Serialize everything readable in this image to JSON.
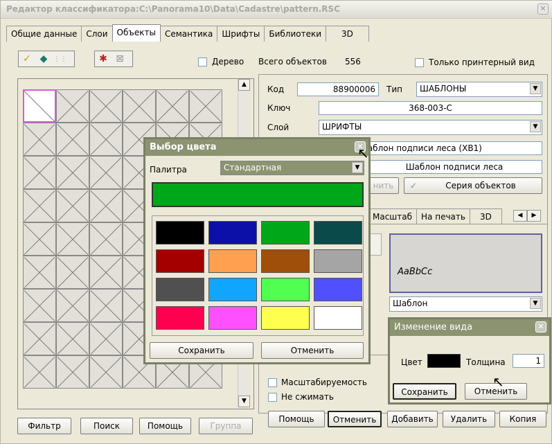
{
  "window": {
    "title": "Редактор классификатора:C:\\Panorama10\\Data\\Cadastre\\pattern.RSC"
  },
  "tabs": [
    "Общие данные",
    "Слои",
    "Объекты",
    "Семантика",
    "Шрифты",
    "Библиотеки",
    "3D"
  ],
  "toolbar": {
    "tree_label": "Дерево",
    "total_label": "Всего объектов",
    "total_value": "556",
    "printer_label": "Только принтерный вид"
  },
  "props": {
    "code_label": "Код",
    "code_value": "88900006",
    "type_label": "Тип",
    "type_value": "ШАБЛОНЫ",
    "key_label": "Ключ",
    "key_value": "368-003-С",
    "layer_label": "Слой",
    "layer_value": "ШРИФТЫ",
    "name_value": "Шаблон подписи леса (ХВ1)",
    "short_value": "Шаблон подписи леса",
    "apply_partial": "нить",
    "series_button": "Серия объектов"
  },
  "subtabs": [
    "Масштаб",
    "На печать",
    "3D"
  ],
  "preview_text": "AaBbCc",
  "template_value": "Шаблон",
  "checks": {
    "scalable": "Масштабируемость",
    "nocompress": "Не сжимать"
  },
  "left_buttons": [
    "Фильтр",
    "Поиск",
    "Помощь",
    "Группа"
  ],
  "bottom_buttons": [
    "Помощь",
    "Отменить",
    "Добавить",
    "Удалить",
    "Копия"
  ],
  "color_dialog": {
    "title": "Выбор цвета",
    "palette_label": "Палитра",
    "palette_value": "Стандартная",
    "current_color": "#00a819",
    "swatches": [
      "#000000",
      "#0c10a8",
      "#00a819",
      "#0a4a4a",
      "#a50000",
      "#ffa050",
      "#a04f0a",
      "#a5a5a5",
      "#505050",
      "#10a5ff",
      "#50ff50",
      "#5050ff",
      "#ff0050",
      "#ff50ff",
      "#ffff50",
      "#ffffff"
    ],
    "save": "Сохранить",
    "cancel": "Отменить"
  },
  "view_dialog": {
    "title": "Изменение вида",
    "color_label": "Цвет",
    "color_value": "#000000",
    "thickness_label": "Толщина",
    "thickness_value": "1",
    "save": "Сохранить",
    "cancel": "Отменить"
  }
}
